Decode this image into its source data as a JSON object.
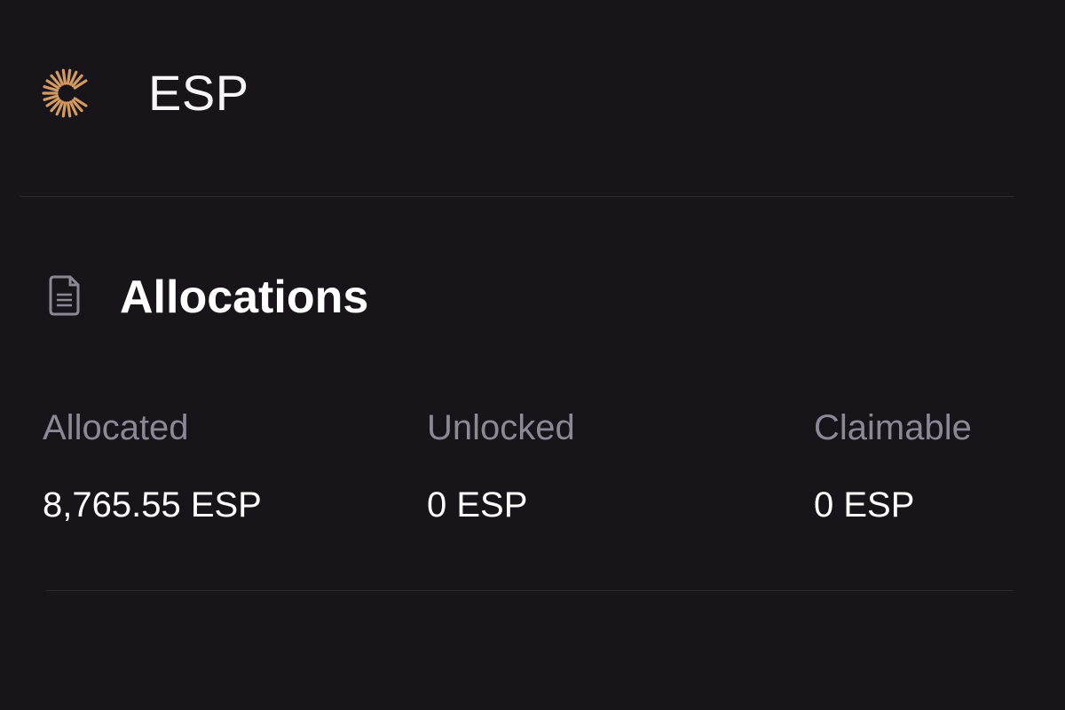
{
  "brand": {
    "title": "ESP",
    "logo_icon": "sunburst-logo",
    "logo_color": "#d59a5f"
  },
  "section": {
    "icon": "document-icon",
    "title": "Allocations"
  },
  "stats": [
    {
      "label": "Allocated",
      "value": "8,765.55 ESP"
    },
    {
      "label": "Unlocked",
      "value": "0 ESP"
    },
    {
      "label": "Claimable",
      "value": "0 ESP"
    }
  ],
  "colors": {
    "background": "#17151a",
    "label": "#8d8895",
    "text": "#ffffff",
    "divider": "#2d2b31"
  }
}
